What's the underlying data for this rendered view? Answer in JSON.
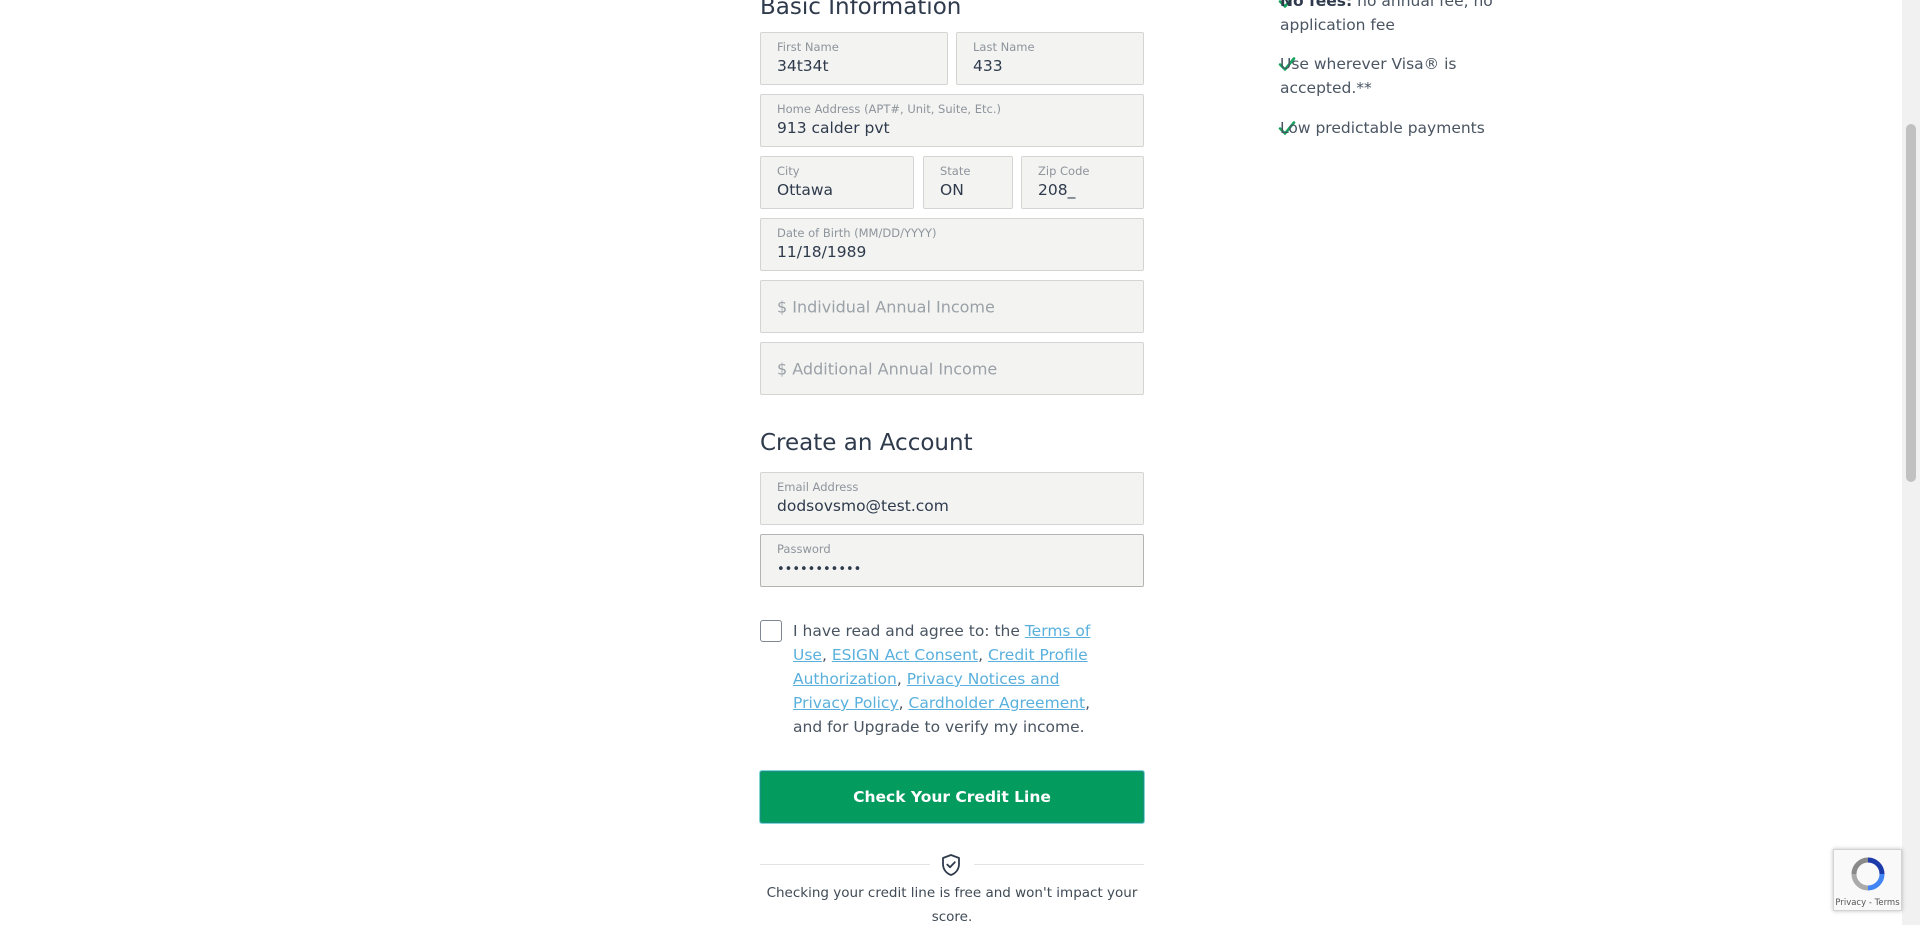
{
  "basic_info": {
    "title": "Basic Information",
    "first_name": {
      "label": "First Name",
      "value": "34t34t"
    },
    "last_name": {
      "label": "Last Name",
      "value": "433"
    },
    "home_address": {
      "label": "Home Address (APT#, Unit, Suite, Etc.)",
      "value": "913 calder pvt"
    },
    "city": {
      "label": "City",
      "value": "Ottawa"
    },
    "state": {
      "label": "State",
      "value": "ON"
    },
    "zip": {
      "label": "Zip Code",
      "value": "208_"
    },
    "dob": {
      "label": "Date of Birth (MM/DD/YYYY)",
      "value": "11/18/1989"
    },
    "individual_income": {
      "placeholder": "$ Individual Annual Income"
    },
    "additional_income": {
      "placeholder": "$ Additional Annual Income"
    }
  },
  "account": {
    "title": "Create an Account",
    "email": {
      "label": "Email Address",
      "value": "dodsovsmo@test.com"
    },
    "password": {
      "label": "Password",
      "value": "•••••••••••"
    }
  },
  "agreement": {
    "checked": false,
    "prefix": "I have read and agree to: the",
    "links": {
      "terms": "Terms of Use",
      "esign": "ESIGN Act Consent",
      "credit_profile": "Credit Profile Authorization",
      "privacy": "Privacy Notices and Privacy Policy",
      "cardholder": "Cardholder Agreement"
    },
    "suffix": "and for Upgrade to verify my income."
  },
  "cta": {
    "label": "Check Your Credit Line"
  },
  "disclaimer": "Checking your credit line is free and won't impact your score.",
  "benefits": [
    {
      "bold": "No fees:",
      "text": "no annual fee, no application fee"
    },
    {
      "text": "Use wherever Visa® is accepted.**"
    },
    {
      "text": "Low predictable payments"
    }
  ],
  "recaptcha": {
    "links": "Privacy - Terms"
  },
  "colors": {
    "accent": "#039b5e",
    "link": "#5ab0dd",
    "check": "#16a35f"
  }
}
